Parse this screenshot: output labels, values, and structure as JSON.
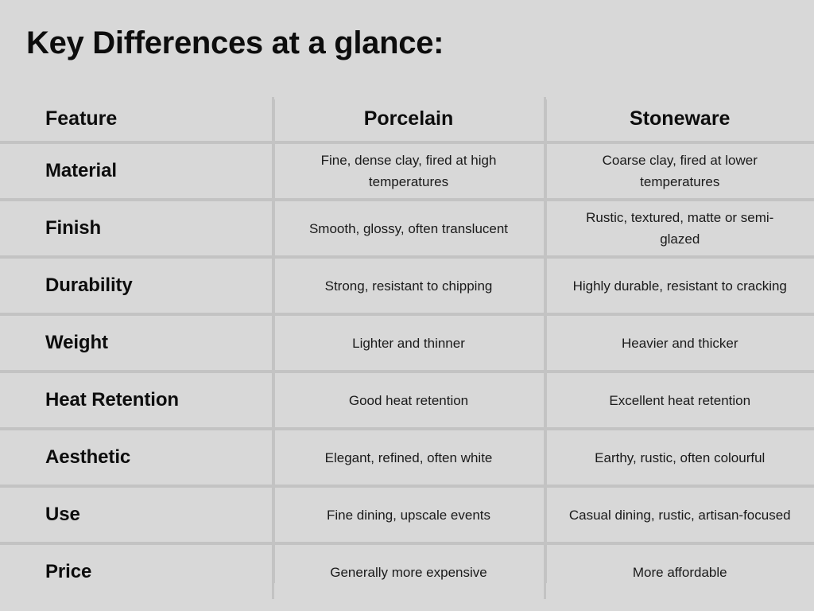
{
  "slide": {
    "title": "Key Differences at a glance:",
    "background_color": "#d8d8d8",
    "text_color": "#111111",
    "rule_color": "#c3c3c3"
  },
  "table": {
    "columns": [
      "Feature",
      "Porcelain",
      "Stoneware"
    ],
    "rows": [
      {
        "feature": "Material",
        "porcelain": "Fine, dense clay, fired at high temperatures",
        "stoneware": "Coarse clay, fired at lower temperatures"
      },
      {
        "feature": "Finish",
        "porcelain": "Smooth, glossy, often translucent",
        "stoneware": "Rustic, textured, matte or semi-glazed"
      },
      {
        "feature": "Durability",
        "porcelain": "Strong, resistant to chipping",
        "stoneware": "Highly durable, resistant to cracking"
      },
      {
        "feature": "Weight",
        "porcelain": "Lighter and thinner",
        "stoneware": "Heavier and thicker"
      },
      {
        "feature": "Heat Retention",
        "porcelain": "Good heat retention",
        "stoneware": "Excellent heat retention"
      },
      {
        "feature": "Aesthetic",
        "porcelain": "Elegant, refined, often white",
        "stoneware": "Earthy, rustic, often colourful"
      },
      {
        "feature": "Use",
        "porcelain": "Fine dining, upscale events",
        "stoneware": "Casual dining, rustic, artisan-focused"
      },
      {
        "feature": "Price",
        "porcelain": "Generally more expensive",
        "stoneware": "More affordable"
      }
    ]
  }
}
